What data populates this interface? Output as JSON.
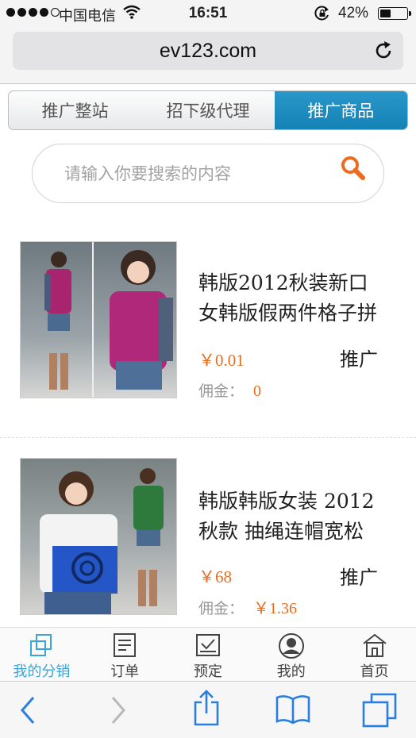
{
  "status_bar": {
    "carrier": "中国电信",
    "time": "16:51",
    "battery_percent": "42%",
    "battery_level": 0.42,
    "signal_bars": 4,
    "signal_total": 5
  },
  "browser": {
    "url": "ev123.com",
    "icons": [
      "reload-icon",
      "back-icon",
      "forward-icon",
      "share-icon",
      "bookmarks-icon",
      "tabs-icon"
    ]
  },
  "tabs": [
    {
      "label": "推广整站",
      "active": false
    },
    {
      "label": "招下级代理",
      "active": false
    },
    {
      "label": "推广商品",
      "active": true
    }
  ],
  "search": {
    "placeholder": "请输入你要搜索的内容",
    "icon": "search-icon"
  },
  "products": [
    {
      "title_line1": "韩版2012秋装新口",
      "title_line2": "女韩版假两件格子拼",
      "price": "￥0.01",
      "promote_label": "推广",
      "commission_label": "佣金：",
      "commission_value": "0"
    },
    {
      "title_line1": "韩版韩版女装 2012",
      "title_line2": "秋款 抽绳连帽宽松",
      "price": "￥68",
      "promote_label": "推广",
      "commission_label": "佣金：",
      "commission_value": "￥1.36"
    }
  ],
  "bottom_nav": [
    {
      "label": "我的分销",
      "icon": "distribution-icon",
      "active": true
    },
    {
      "label": "订单",
      "icon": "order-icon",
      "active": false
    },
    {
      "label": "预定",
      "icon": "reserve-icon",
      "active": false
    },
    {
      "label": "我的",
      "icon": "user-icon",
      "active": false
    },
    {
      "label": "首页",
      "icon": "home-icon",
      "active": false
    }
  ],
  "colors": {
    "accent_blue": "#1f8ec4",
    "price_orange": "#ea6d1f",
    "nav_active": "#3ba4d8"
  }
}
